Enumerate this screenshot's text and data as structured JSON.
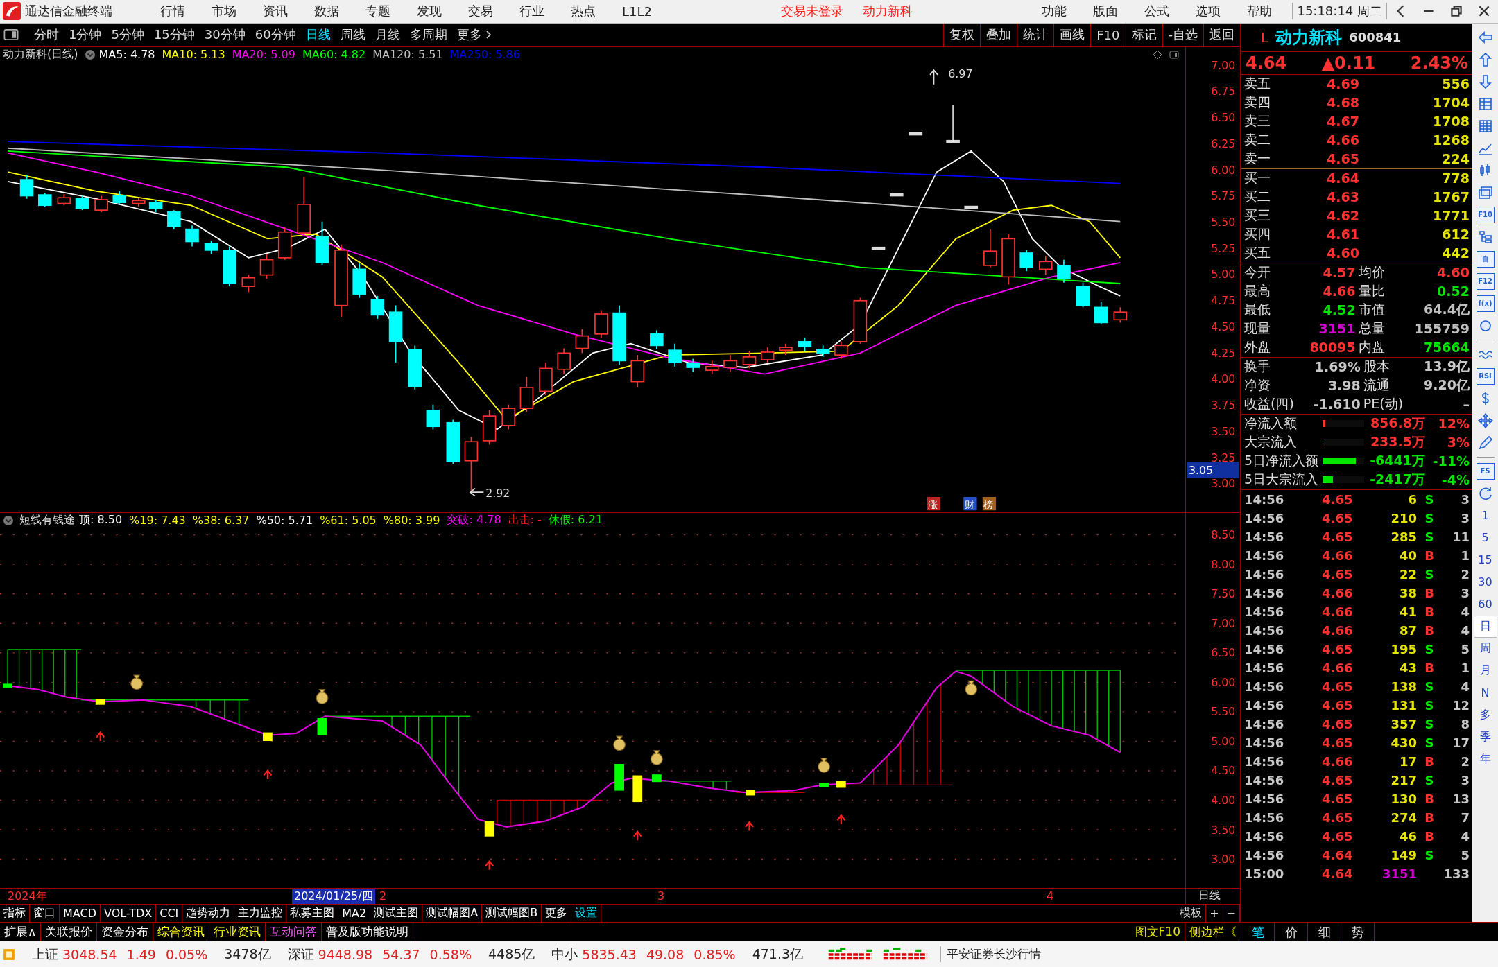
{
  "menu_bar": {
    "app_title": "通达信金融终端",
    "menus": [
      "行情",
      "市场",
      "资讯",
      "数据",
      "专题",
      "发现",
      "交易",
      "行业",
      "热点",
      "L1L2"
    ],
    "notices": [
      "交易未登录",
      "动力新科"
    ],
    "right_menus": [
      "功能",
      "版面",
      "公式",
      "选项",
      "帮助"
    ],
    "clock": "15:18:14",
    "weekday": "周二"
  },
  "period_tabs": [
    {
      "label": "分时",
      "selected": false
    },
    {
      "label": "1分钟",
      "selected": false
    },
    {
      "label": "5分钟",
      "selected": false
    },
    {
      "label": "15分钟",
      "selected": false
    },
    {
      "label": "30分钟",
      "selected": false
    },
    {
      "label": "60分钟",
      "selected": false
    },
    {
      "label": "日线",
      "selected": true
    },
    {
      "label": "周线",
      "selected": false
    },
    {
      "label": "月线",
      "selected": false
    },
    {
      "label": "多周期",
      "selected": false
    },
    {
      "label": "更多",
      "selected": false
    }
  ],
  "chart_tools": [
    "复权",
    "叠加",
    "统计",
    "画线",
    "F10",
    "标记",
    "-自选",
    "返回"
  ],
  "stock_header": {
    "market": "L",
    "name": "动力新科",
    "code": "600841"
  },
  "main_chart": {
    "title": "动力新科(日线)",
    "ma": [
      {
        "label": "MA5: 4.78",
        "color": "#ffffff"
      },
      {
        "label": "MA10: 5.13",
        "color": "#ffff00"
      },
      {
        "label": "MA20: 5.09",
        "color": "#ff00ff"
      },
      {
        "label": "MA60: 4.82",
        "color": "#00ff00"
      },
      {
        "label": "MA120: 5.51",
        "color": "#c0c0c0"
      },
      {
        "label": "MA250: 5.86",
        "color": "#0000ff"
      }
    ],
    "yticks": [
      "7.00",
      "6.75",
      "6.50",
      "6.25",
      "6.00",
      "5.75",
      "5.50",
      "5.25",
      "5.00",
      "4.75",
      "4.50",
      "4.25",
      "4.00",
      "3.75",
      "3.50",
      "3.25",
      "3.00"
    ],
    "high_label": "6.97",
    "low_label": "2.92",
    "cursor_price": "3.05",
    "markers": [
      {
        "label": "涨",
        "color": "#c02020"
      },
      {
        "label": "财",
        "color": "#2050c0"
      },
      {
        "label": "榜",
        "color": "#a06020"
      }
    ]
  },
  "indicator": {
    "title": "短线有钱途",
    "values": [
      {
        "label": "顶: 8.50",
        "color": "#ffffff"
      },
      {
        "label": "%19: 7.43",
        "color": "#ffff00"
      },
      {
        "label": "%38: 6.37",
        "color": "#ffff00"
      },
      {
        "label": "%50: 5.71",
        "color": "#ffffff"
      },
      {
        "label": "%61: 5.05",
        "color": "#ffff00"
      },
      {
        "label": "%80: 3.99",
        "color": "#ffff00"
      },
      {
        "label": "突破: 4.78",
        "color": "#ff00ff"
      },
      {
        "label": "出击: -",
        "color": "#ff2020"
      },
      {
        "label": "休假: 6.21",
        "color": "#00ff00"
      }
    ],
    "yticks": [
      "8.50",
      "8.00",
      "7.50",
      "7.00",
      "6.50",
      "6.00",
      "5.50",
      "5.00",
      "4.50",
      "4.00",
      "3.50",
      "3.00"
    ]
  },
  "date_bar": {
    "year": "2024年",
    "cursor_date": "2024/01/25/四",
    "months": [
      "2",
      "3",
      "4"
    ],
    "period": "日线"
  },
  "bottom_tabs": [
    {
      "label": "指标",
      "color": "#ffffff"
    },
    {
      "label": "窗口",
      "color": "#ffffff"
    },
    {
      "label": "MACD",
      "color": "#ffffff"
    },
    {
      "label": "VOL-TDX",
      "color": "#ffffff"
    },
    {
      "label": "CCI",
      "color": "#ffffff"
    },
    {
      "label": "趋势动力",
      "color": "#ffffff"
    },
    {
      "label": "主力监控",
      "color": "#ffffff"
    },
    {
      "label": "私募主图",
      "color": "#ffffff"
    },
    {
      "label": "MA2",
      "color": "#ffffff"
    },
    {
      "label": "测试主图",
      "color": "#ffffff"
    },
    {
      "label": "测试幅图A",
      "color": "#ffffff"
    },
    {
      "label": "测试幅图B",
      "color": "#ffffff"
    },
    {
      "label": "更多",
      "color": "#ffffff"
    },
    {
      "label": "设置",
      "color": "#00e4ff"
    }
  ],
  "bottom_tools": [
    "模板",
    "+",
    "−"
  ],
  "info_tabs": [
    {
      "label": "扩展∧",
      "color": "#ffffff"
    },
    {
      "label": "关联报价",
      "color": "#ffffff"
    },
    {
      "label": "资金分布",
      "color": "#ffffff"
    },
    {
      "label": "综合资讯",
      "color": "#ffff00"
    },
    {
      "label": "行业资讯",
      "color": "#ffff00"
    },
    {
      "label": "互动问答",
      "color": "#ff60ff"
    },
    {
      "label": "普及版功能说明",
      "color": "#ffffff"
    }
  ],
  "side_links": [
    "图文F10",
    "侧边栏《"
  ],
  "panel_tabs": [
    {
      "label": "笔",
      "selected": true
    },
    {
      "label": "价",
      "selected": false
    },
    {
      "label": "细",
      "selected": false
    },
    {
      "label": "势",
      "selected": false
    }
  ],
  "quote": {
    "price": "4.64",
    "change": "▲0.11",
    "percent": "2.43%",
    "asks": [
      {
        "label": "卖五",
        "price": "4.69",
        "volume": "556"
      },
      {
        "label": "卖四",
        "price": "4.68",
        "volume": "1704"
      },
      {
        "label": "卖三",
        "price": "4.67",
        "volume": "1708"
      },
      {
        "label": "卖二",
        "price": "4.66",
        "volume": "1268"
      },
      {
        "label": "卖一",
        "price": "4.65",
        "volume": "224"
      }
    ],
    "bids": [
      {
        "label": "买一",
        "price": "4.64",
        "volume": "778"
      },
      {
        "label": "买二",
        "price": "4.63",
        "volume": "1767"
      },
      {
        "label": "买三",
        "price": "4.62",
        "volume": "1771"
      },
      {
        "label": "买四",
        "price": "4.61",
        "volume": "612"
      },
      {
        "label": "买五",
        "price": "4.60",
        "volume": "442"
      }
    ],
    "stats": [
      {
        "label": "今开",
        "value": "4.57",
        "color": "#ff3232"
      },
      {
        "label": "均价",
        "value": "4.60",
        "color": "#ff3232"
      },
      {
        "label": "最高",
        "value": "4.66",
        "color": "#ff3232"
      },
      {
        "label": "量比",
        "value": "0.52",
        "color": "#00e600"
      },
      {
        "label": "最低",
        "value": "4.52",
        "color": "#00e600"
      },
      {
        "label": "市值",
        "value": "64.4亿",
        "color": "#c0c0c0"
      },
      {
        "label": "现量",
        "value": "3151",
        "color": "#d000d0"
      },
      {
        "label": "总量",
        "value": "155759",
        "color": "#c0c0c0"
      },
      {
        "label": "外盘",
        "value": "80095",
        "color": "#ff3232"
      },
      {
        "label": "内盘",
        "value": "75664",
        "color": "#00e600"
      }
    ],
    "fundamentals": [
      {
        "label": "换手",
        "value": "1.69%"
      },
      {
        "label": "股本",
        "value": "13.9亿"
      },
      {
        "label": "净资",
        "value": "3.98"
      },
      {
        "label": "流通",
        "value": "9.20亿"
      },
      {
        "label": "收益(四)",
        "value": "-1.610"
      },
      {
        "label": "PE(动)",
        "value": "–"
      }
    ],
    "flows": [
      {
        "label": "净流入额",
        "level": 0.06,
        "amount": "856.8万",
        "percent": "12%",
        "color": "#ff3232"
      },
      {
        "label": "大宗流入",
        "level": 0.02,
        "amount": "233.5万",
        "percent": "3%",
        "color": "#ff3232"
      },
      {
        "label": "5日净流入额",
        "level": 0.8,
        "amount": "-6441万",
        "percent": "-11%",
        "color": "#00e600"
      },
      {
        "label": "5日大宗流入",
        "level": 0.25,
        "amount": "-2417万",
        "percent": "-4%",
        "color": "#00e600"
      }
    ]
  },
  "ticks": [
    {
      "time": "14:56",
      "price": "4.65",
      "volume": "6",
      "side": "S",
      "kind": "sell",
      "count": "3"
    },
    {
      "time": "14:56",
      "price": "4.65",
      "volume": "210",
      "side": "S",
      "kind": "sell",
      "count": "3"
    },
    {
      "time": "14:56",
      "price": "4.65",
      "volume": "285",
      "side": "S",
      "kind": "sell",
      "count": "11"
    },
    {
      "time": "14:56",
      "price": "4.66",
      "volume": "40",
      "side": "B",
      "kind": "buy",
      "count": "1"
    },
    {
      "time": "14:56",
      "price": "4.65",
      "volume": "22",
      "side": "S",
      "kind": "sell",
      "count": "2"
    },
    {
      "time": "14:56",
      "price": "4.66",
      "volume": "38",
      "side": "B",
      "kind": "buy",
      "count": "3"
    },
    {
      "time": "14:56",
      "price": "4.66",
      "volume": "41",
      "side": "B",
      "kind": "buy",
      "count": "4"
    },
    {
      "time": "14:56",
      "price": "4.66",
      "volume": "87",
      "side": "B",
      "kind": "buy",
      "count": "4"
    },
    {
      "time": "14:56",
      "price": "4.65",
      "volume": "195",
      "side": "S",
      "kind": "sell",
      "count": "5"
    },
    {
      "time": "14:56",
      "price": "4.66",
      "volume": "43",
      "side": "B",
      "kind": "buy",
      "count": "1"
    },
    {
      "time": "14:56",
      "price": "4.65",
      "volume": "138",
      "side": "S",
      "kind": "sell",
      "count": "4"
    },
    {
      "time": "14:56",
      "price": "4.65",
      "volume": "131",
      "side": "S",
      "kind": "sell",
      "count": "12"
    },
    {
      "time": "14:56",
      "price": "4.65",
      "volume": "357",
      "side": "S",
      "kind": "sell",
      "count": "8"
    },
    {
      "time": "14:56",
      "price": "4.65",
      "volume": "430",
      "side": "S",
      "kind": "sell",
      "count": "17"
    },
    {
      "time": "14:56",
      "price": "4.66",
      "volume": "17",
      "side": "B",
      "kind": "buy",
      "count": "2"
    },
    {
      "time": "14:56",
      "price": "4.65",
      "volume": "217",
      "side": "S",
      "kind": "sell",
      "count": "3"
    },
    {
      "time": "14:56",
      "price": "4.65",
      "volume": "130",
      "side": "B",
      "kind": "buy",
      "count": "13"
    },
    {
      "time": "14:56",
      "price": "4.65",
      "volume": "274",
      "side": "B",
      "kind": "buy",
      "count": "7"
    },
    {
      "time": "14:56",
      "price": "4.65",
      "volume": "46",
      "side": "B",
      "kind": "buy",
      "count": "4"
    },
    {
      "time": "14:56",
      "price": "4.64",
      "volume": "149",
      "side": "S",
      "kind": "sell",
      "count": "5"
    },
    {
      "time": "15:00",
      "price": "4.64",
      "volume": "3151",
      "kind": "total",
      "count": "133"
    }
  ],
  "side_toolbar": {
    "labels": [
      "F10",
      "自",
      "F12",
      "f(x)",
      "RSI",
      "F5"
    ],
    "periods": [
      {
        "label": "1",
        "selected": false
      },
      {
        "label": "5",
        "selected": false
      },
      {
        "label": "15",
        "selected": false
      },
      {
        "label": "30",
        "selected": false
      },
      {
        "label": "60",
        "selected": false
      },
      {
        "label": "日",
        "selected": true
      },
      {
        "label": "周",
        "selected": false
      },
      {
        "label": "月",
        "selected": false
      },
      {
        "label": "N",
        "selected": false
      },
      {
        "label": "多",
        "selected": false
      },
      {
        "label": "季",
        "selected": false
      },
      {
        "label": "年",
        "selected": false
      }
    ]
  },
  "status_bar": {
    "indices": [
      {
        "name": "上证",
        "value": "3048.54",
        "change": "1.49",
        "percent": "0.05%",
        "amount": "3478亿"
      },
      {
        "name": "深证",
        "value": "9448.98",
        "change": "54.37",
        "percent": "0.58%",
        "amount": "4485亿"
      },
      {
        "name": "中小",
        "value": "5835.43",
        "change": "49.08",
        "percent": "0.85%",
        "amount": "471.3亿"
      }
    ],
    "broker": "平安证券长沙行情"
  }
}
